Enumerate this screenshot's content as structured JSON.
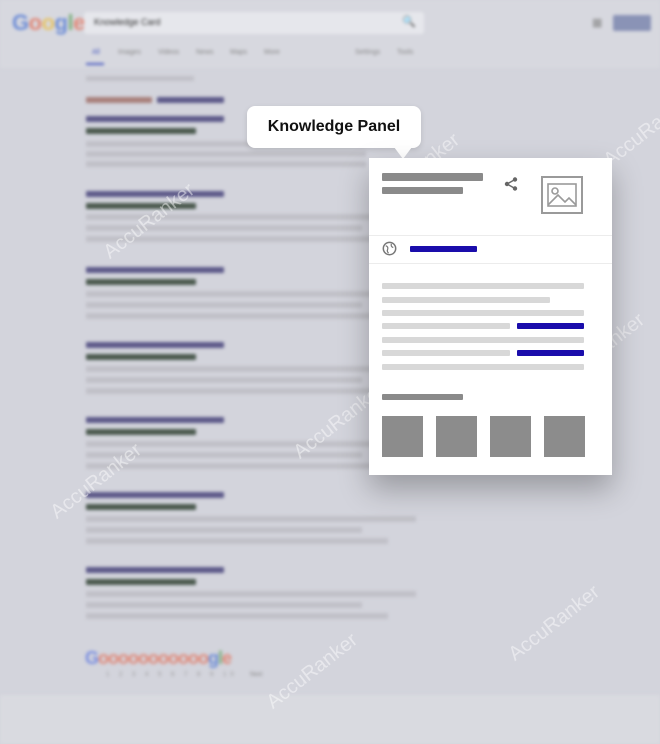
{
  "search": {
    "logo": "Google",
    "query": "Knowledge Card",
    "tabs": [
      "All",
      "Images",
      "Videos",
      "News",
      "Maps",
      "More"
    ],
    "tools": [
      "Settings",
      "Tools"
    ]
  },
  "callout": {
    "label": "Knowledge Panel"
  },
  "footer": {
    "logo": "Goooooooooogle",
    "pages": "1 2 3 4 5 6 7 8 9 10",
    "next": "Next"
  },
  "watermark": {
    "text": "AccuRanker"
  },
  "colors": {
    "background": "#d3d4dc",
    "result_title": "#5d5a8a",
    "result_url": "#4b5a4f",
    "link_blue": "#1a0dab",
    "panel_bg": "#ffffff"
  },
  "icons": [
    "search-icon",
    "apps-icon",
    "share-icon",
    "image-placeholder-icon",
    "globe-icon"
  ]
}
